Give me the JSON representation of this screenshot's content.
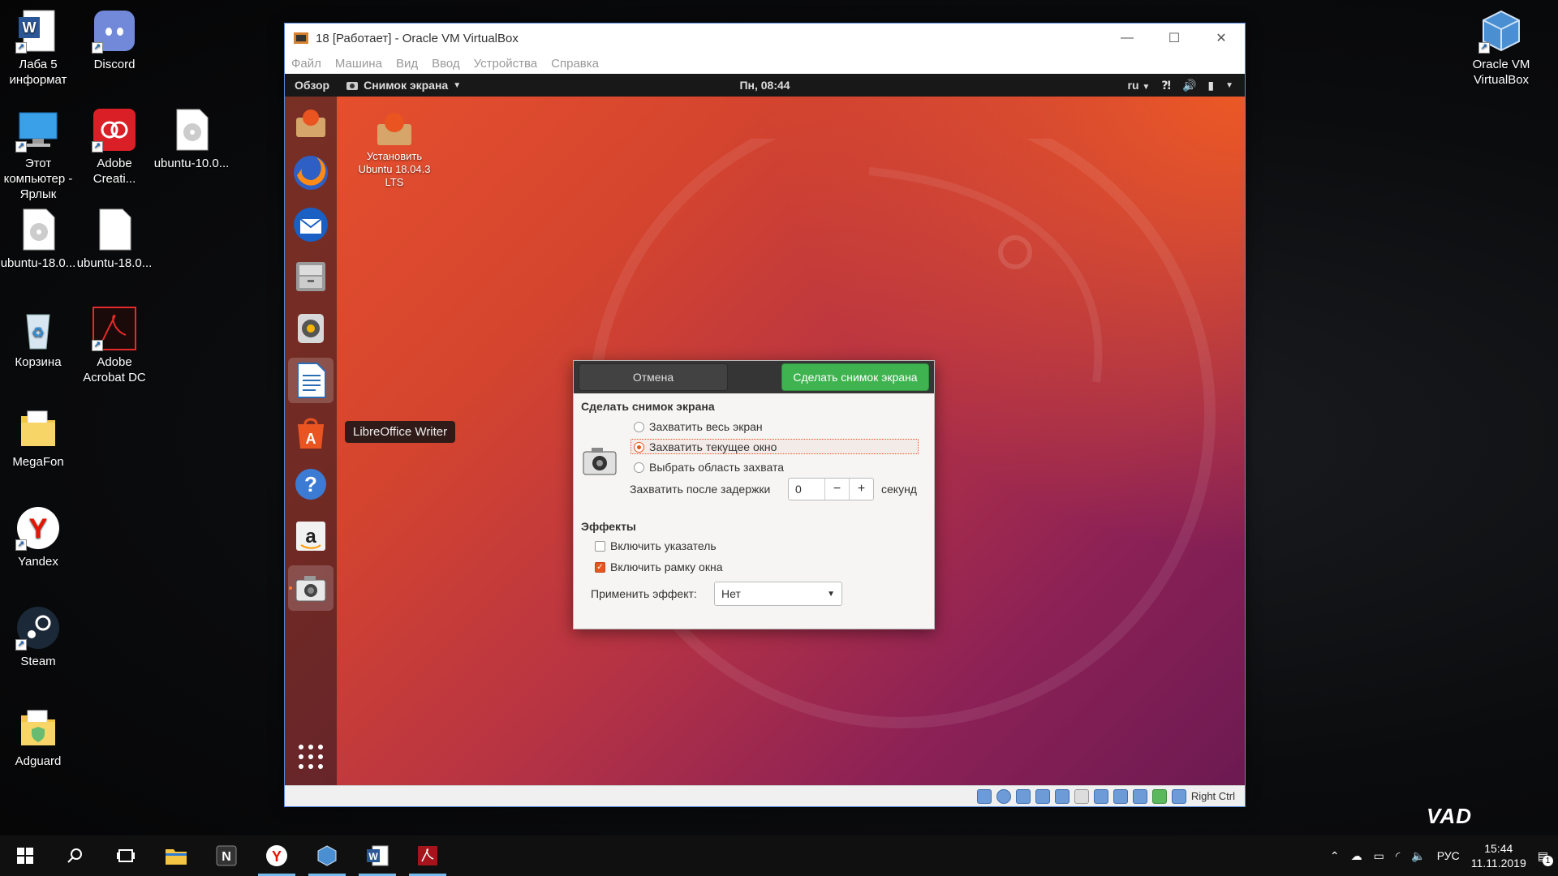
{
  "desktop": {
    "icons": [
      {
        "label": "Лаба 5 информат"
      },
      {
        "label": "Discord"
      },
      {
        "label": "Этот компьютер - Ярлык"
      },
      {
        "label": "Adobe Creati..."
      },
      {
        "label": "ubuntu-10.0..."
      },
      {
        "label": "ubuntu-18.0..."
      },
      {
        "label": "ubuntu-18.0..."
      },
      {
        "label": "Корзина"
      },
      {
        "label": "Adobe Acrobat DC"
      },
      {
        "label": "MegaFon"
      },
      {
        "label": "Yandex"
      },
      {
        "label": "Steam"
      },
      {
        "label": "Adguard"
      },
      {
        "label": "Oracle VM VirtualBox"
      }
    ],
    "watermark": "VAD"
  },
  "vbox": {
    "title": "18 [Работает] - Oracle VM VirtualBox",
    "menu": [
      "Файл",
      "Машина",
      "Вид",
      "Ввод",
      "Устройства",
      "Справка"
    ],
    "status_host_key": "Right Ctrl"
  },
  "ubuntu": {
    "topbar": {
      "overview": "Обзор",
      "app_menu": "Снимок экрана",
      "clock": "Пн, 08:44",
      "lang": "ru"
    },
    "dock_tooltip": "LibreOffice Writer",
    "desktop_icon": "Установить Ubuntu 18.04.3 LTS",
    "dialog": {
      "cancel": "Отмена",
      "take": "Сделать снимок экрана",
      "section_title": "Сделать снимок экрана",
      "options": [
        "Захватить весь экран",
        "Захватить текущее окно",
        "Выбрать область захвата"
      ],
      "delay_label": "Захватить после задержки",
      "delay_value": "0",
      "minus": "−",
      "plus": "+",
      "delay_unit": "секунд",
      "effects_title": "Эффекты",
      "include_pointer": "Включить указатель",
      "include_border": "Включить рамку окна",
      "apply_effect_label": "Применить эффект:",
      "apply_effect_value": "Нет"
    }
  },
  "taskbar": {
    "lang": "РУС",
    "time": "15:44",
    "date": "11.11.2019",
    "notif_count": "1"
  }
}
